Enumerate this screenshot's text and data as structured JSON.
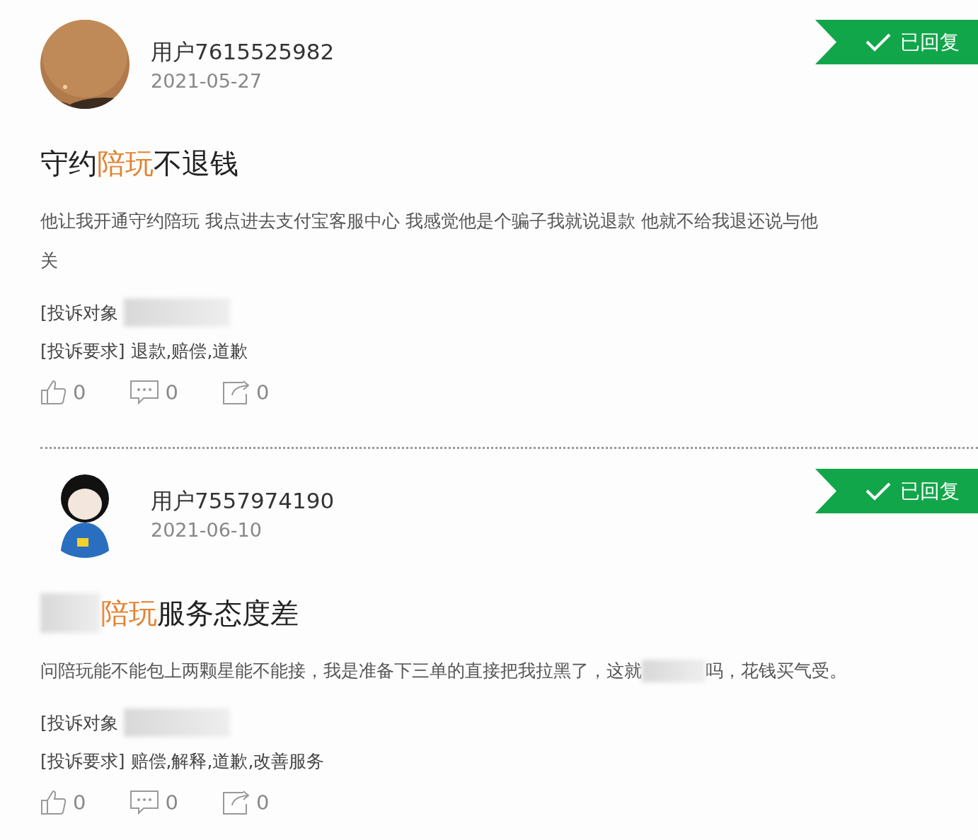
{
  "complaints": [
    {
      "user": "用户7615525982",
      "date": "2021-05-27",
      "avatar": {
        "kind": "picture"
      },
      "replied": true,
      "status": "已回复",
      "title": [
        {
          "kind": "text",
          "text": "守约"
        },
        {
          "kind": "highlight",
          "text": "陪玩"
        },
        {
          "kind": "text",
          "text": "不退钱"
        }
      ],
      "body": [
        [
          {
            "kind": "text",
            "text": "他让我开通守约陪玩 我点进去支付宝客服中心 我感觉他是个骗子我就说退款 他就不给我退还说与他"
          }
        ],
        [
          {
            "kind": "text",
            "text": "关"
          }
        ]
      ],
      "fields": [
        {
          "label": "[投诉对象",
          "value": [
            {
              "kind": "redacted"
            }
          ]
        },
        {
          "label": "[投诉要求]",
          "value": [
            {
              "kind": "text",
              "text": "退款,赔偿,道歉"
            }
          ]
        }
      ],
      "likes": "0",
      "comments": "0",
      "shares": "0"
    },
    {
      "user": "用户7557974190",
      "date": "2021-06-10",
      "avatar": {
        "kind": "figure"
      },
      "replied": true,
      "status": "已回复",
      "title": [
        {
          "kind": "redacted"
        },
        {
          "kind": "highlight",
          "text": "陪玩"
        },
        {
          "kind": "text",
          "text": "服务态度差"
        }
      ],
      "body": [
        [
          {
            "kind": "text",
            "text": "问陪玩能不能包上两颗星能不能接，我是准备下三单的直接把我拉黑了，这就"
          },
          {
            "kind": "redacted"
          },
          {
            "kind": "text",
            "text": "吗，花钱买气受。"
          }
        ]
      ],
      "fields": [
        {
          "label": "[投诉对象",
          "value": [
            {
              "kind": "redacted"
            }
          ]
        },
        {
          "label": "[投诉要求]",
          "value": [
            {
              "kind": "text",
              "text": "赔偿,解释,道歉,改善服务"
            }
          ]
        }
      ],
      "likes": "0",
      "comments": "0",
      "shares": "0"
    }
  ]
}
